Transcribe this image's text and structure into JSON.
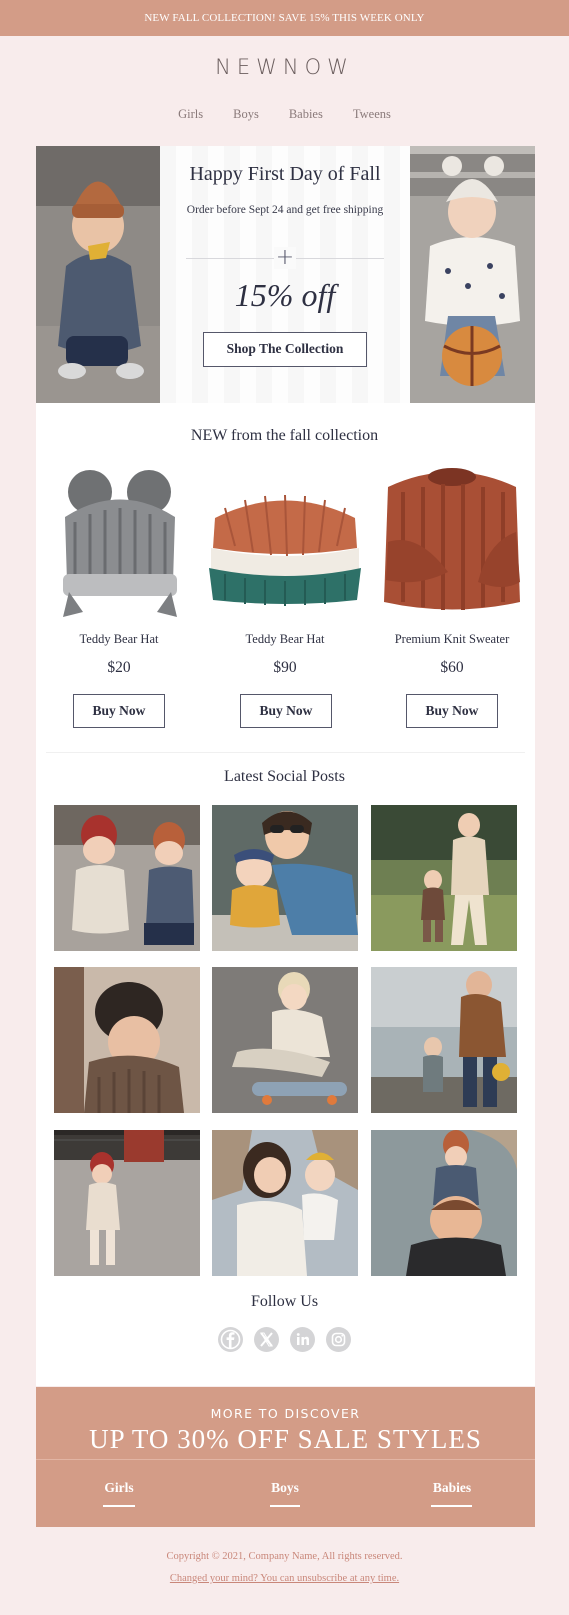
{
  "announcement": "NEW FALL COLLECTION! SAVE 15% THIS WEEK ONLY",
  "logo": "NEWNOW",
  "nav": [
    "Girls",
    "Boys",
    "Babies",
    "Tweens"
  ],
  "hero": {
    "title": "Happy First Day of Fall",
    "subtitle": "Order before Sept 24 and get free shipping",
    "discount": "15% off",
    "cta": "Shop The Collection"
  },
  "new_section": {
    "title": "NEW from the fall collection",
    "products": [
      {
        "name": "Teddy Bear Hat",
        "price": "$20",
        "cta": "Buy Now"
      },
      {
        "name": "Teddy Bear Hat",
        "price": "$90",
        "cta": "Buy Now"
      },
      {
        "name": "Premium Knit Sweater",
        "price": "$60",
        "cta": "Buy Now"
      }
    ]
  },
  "social": {
    "title": "Latest Social Posts",
    "follow_title": "Follow Us",
    "icons": [
      "facebook-icon",
      "x-icon",
      "linkedin-icon",
      "instagram-icon"
    ]
  },
  "promo": {
    "subtitle": "MORE TO DISCOVER",
    "title": "UP TO 30% OFF SALE STYLES",
    "links": [
      "Girls",
      "Boys",
      "Babies"
    ]
  },
  "footer": {
    "copyright": "Copyright © 2021, Company Name, All rights reserved.",
    "unsubscribe": "Changed your mind? You can unsubscribe at any time."
  },
  "colors": {
    "accent": "#d39c87",
    "page_bg": "#f8ecec",
    "text": "#2e3042"
  }
}
